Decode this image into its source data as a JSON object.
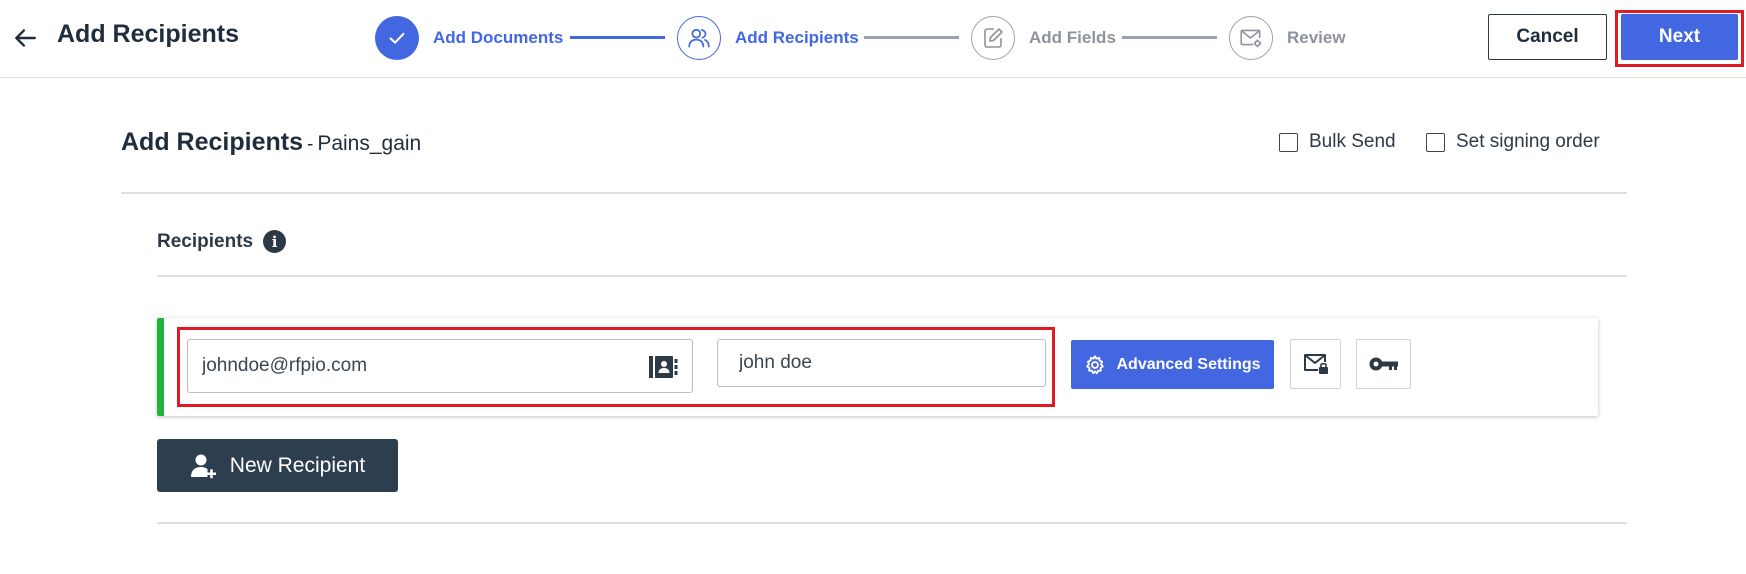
{
  "header": {
    "title": "Add Recipients",
    "back_icon": "arrow-left-icon",
    "steps": [
      {
        "label": "Add Documents",
        "state": "done",
        "icon": "check-icon"
      },
      {
        "label": "Add Recipients",
        "state": "active",
        "icon": "users-icon"
      },
      {
        "label": "Add Fields",
        "state": "pending",
        "icon": "edit-document-icon"
      },
      {
        "label": "Review",
        "state": "pending",
        "icon": "mail-gear-icon"
      }
    ],
    "cancel_label": "Cancel",
    "next_label": "Next"
  },
  "section": {
    "title": "Add Recipients",
    "separator": "-",
    "document_name": "Pains_gain",
    "bulk_send_label": "Bulk Send",
    "bulk_send_checked": false,
    "signing_order_label": "Set signing order",
    "signing_order_checked": false
  },
  "recipients": {
    "title": "Recipients",
    "info_icon_glyph": "i",
    "items": [
      {
        "email": "johndoe@rfpio.com",
        "name": "john doe",
        "advanced_settings_label": "Advanced Settings"
      }
    ],
    "new_recipient_label": "New Recipient"
  },
  "colors": {
    "accent": "#4267e0",
    "highlight": "#e01b24",
    "card_accent": "#22b33c",
    "dark_button": "#2d3e4f"
  }
}
